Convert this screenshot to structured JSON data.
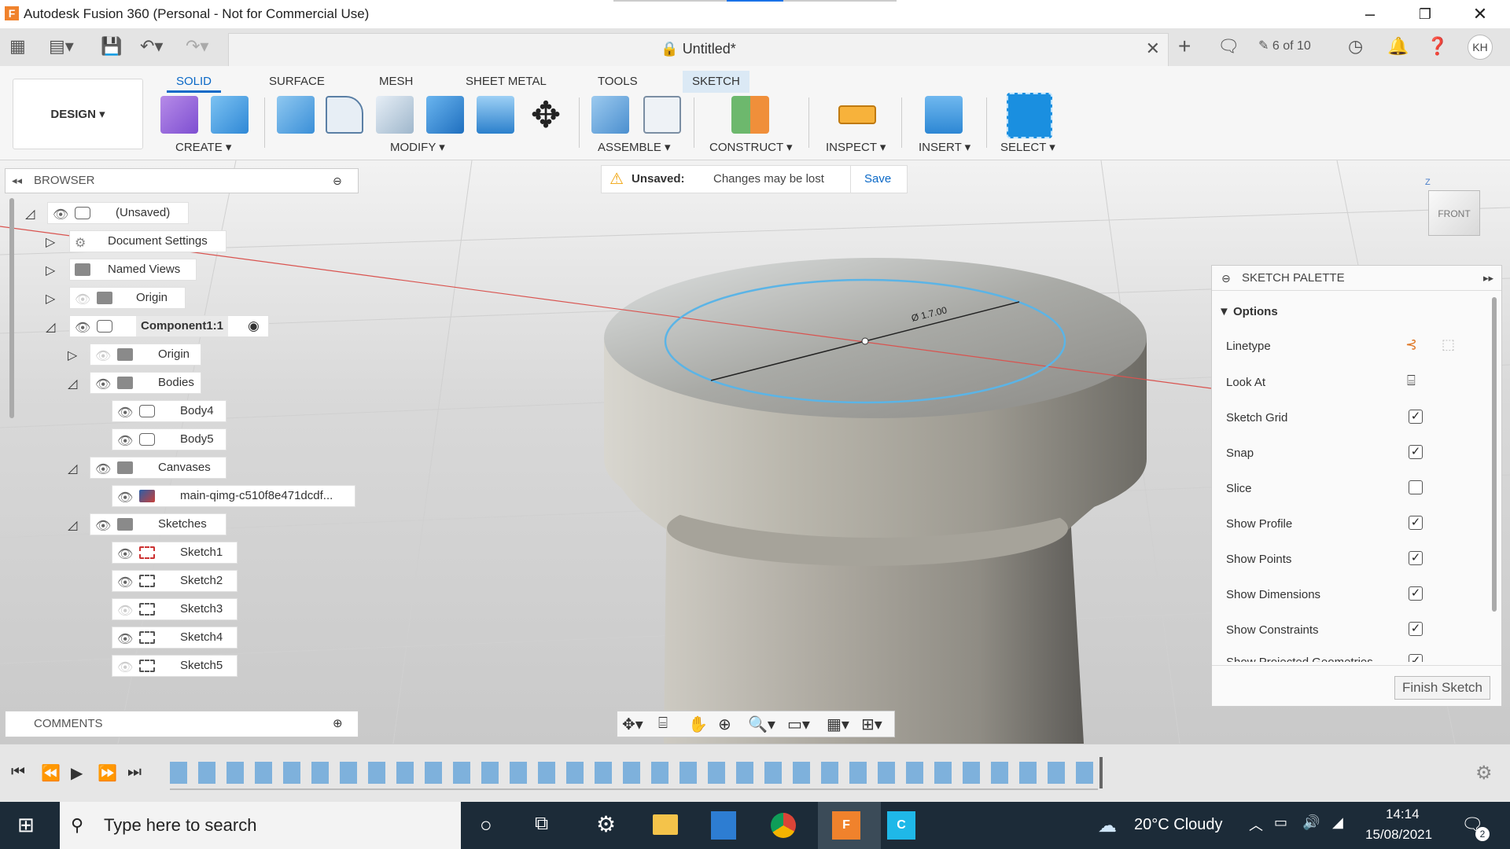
{
  "window": {
    "title": "Autodesk Fusion 360 (Personal - Not for Commercial Use)",
    "app_icon": "F",
    "minimize": "–",
    "restore": "❐",
    "close": "✕"
  },
  "tabbar": {
    "doc_name": "Untitled*",
    "version_label": "6 of 10",
    "user_initials": "KH"
  },
  "ribbon": {
    "workspace": "DESIGN",
    "tabs": [
      "SOLID",
      "SURFACE",
      "MESH",
      "SHEET METAL",
      "TOOLS",
      "SKETCH"
    ],
    "groups": [
      "CREATE",
      "MODIFY",
      "ASSEMBLE",
      "CONSTRUCT",
      "INSPECT",
      "INSERT",
      "SELECT"
    ]
  },
  "notice": {
    "title": "Unsaved:",
    "message": "Changes may be lost",
    "save": "Save"
  },
  "browser": {
    "title": "BROWSER",
    "nodes": [
      {
        "label": "(Unsaved)"
      },
      {
        "label": "Document Settings"
      },
      {
        "label": "Named Views"
      },
      {
        "label": "Origin"
      },
      {
        "label": "Component1:1"
      },
      {
        "label": "Origin"
      },
      {
        "label": "Bodies"
      },
      {
        "label": "Body4"
      },
      {
        "label": "Body5"
      },
      {
        "label": "Canvases"
      },
      {
        "label": "main-qimg-c510f8e471dcdf..."
      },
      {
        "label": "Sketches"
      },
      {
        "label": "Sketch1"
      },
      {
        "label": "Sketch2"
      },
      {
        "label": "Sketch3"
      },
      {
        "label": "Sketch4"
      },
      {
        "label": "Sketch5"
      }
    ]
  },
  "comments": {
    "title": "COMMENTS"
  },
  "viewcube": {
    "face": "FRONT",
    "axis": "Z"
  },
  "dimension_label": "Ø 1.7.00",
  "palette": {
    "title": "SKETCH PALETTE",
    "section": "Options",
    "rows": [
      {
        "label": "Linetype",
        "checked": null
      },
      {
        "label": "Look At",
        "checked": null
      },
      {
        "label": "Sketch Grid",
        "checked": true
      },
      {
        "label": "Snap",
        "checked": true
      },
      {
        "label": "Slice",
        "checked": false
      },
      {
        "label": "Show Profile",
        "checked": true
      },
      {
        "label": "Show Points",
        "checked": true
      },
      {
        "label": "Show Dimensions",
        "checked": true
      },
      {
        "label": "Show Constraints",
        "checked": true
      },
      {
        "label": "Show Projected Geometries",
        "checked": true
      }
    ],
    "finish": "Finish Sketch"
  },
  "taskbar": {
    "search_placeholder": "Type here to search",
    "weather": "20°C  Cloudy",
    "time": "14:14",
    "date": "15/08/2021",
    "notifications": "2"
  },
  "colors": {
    "accent": "#0b69c7",
    "sketch_line": "#5bb4e6",
    "axis_red": "#d9534f"
  }
}
